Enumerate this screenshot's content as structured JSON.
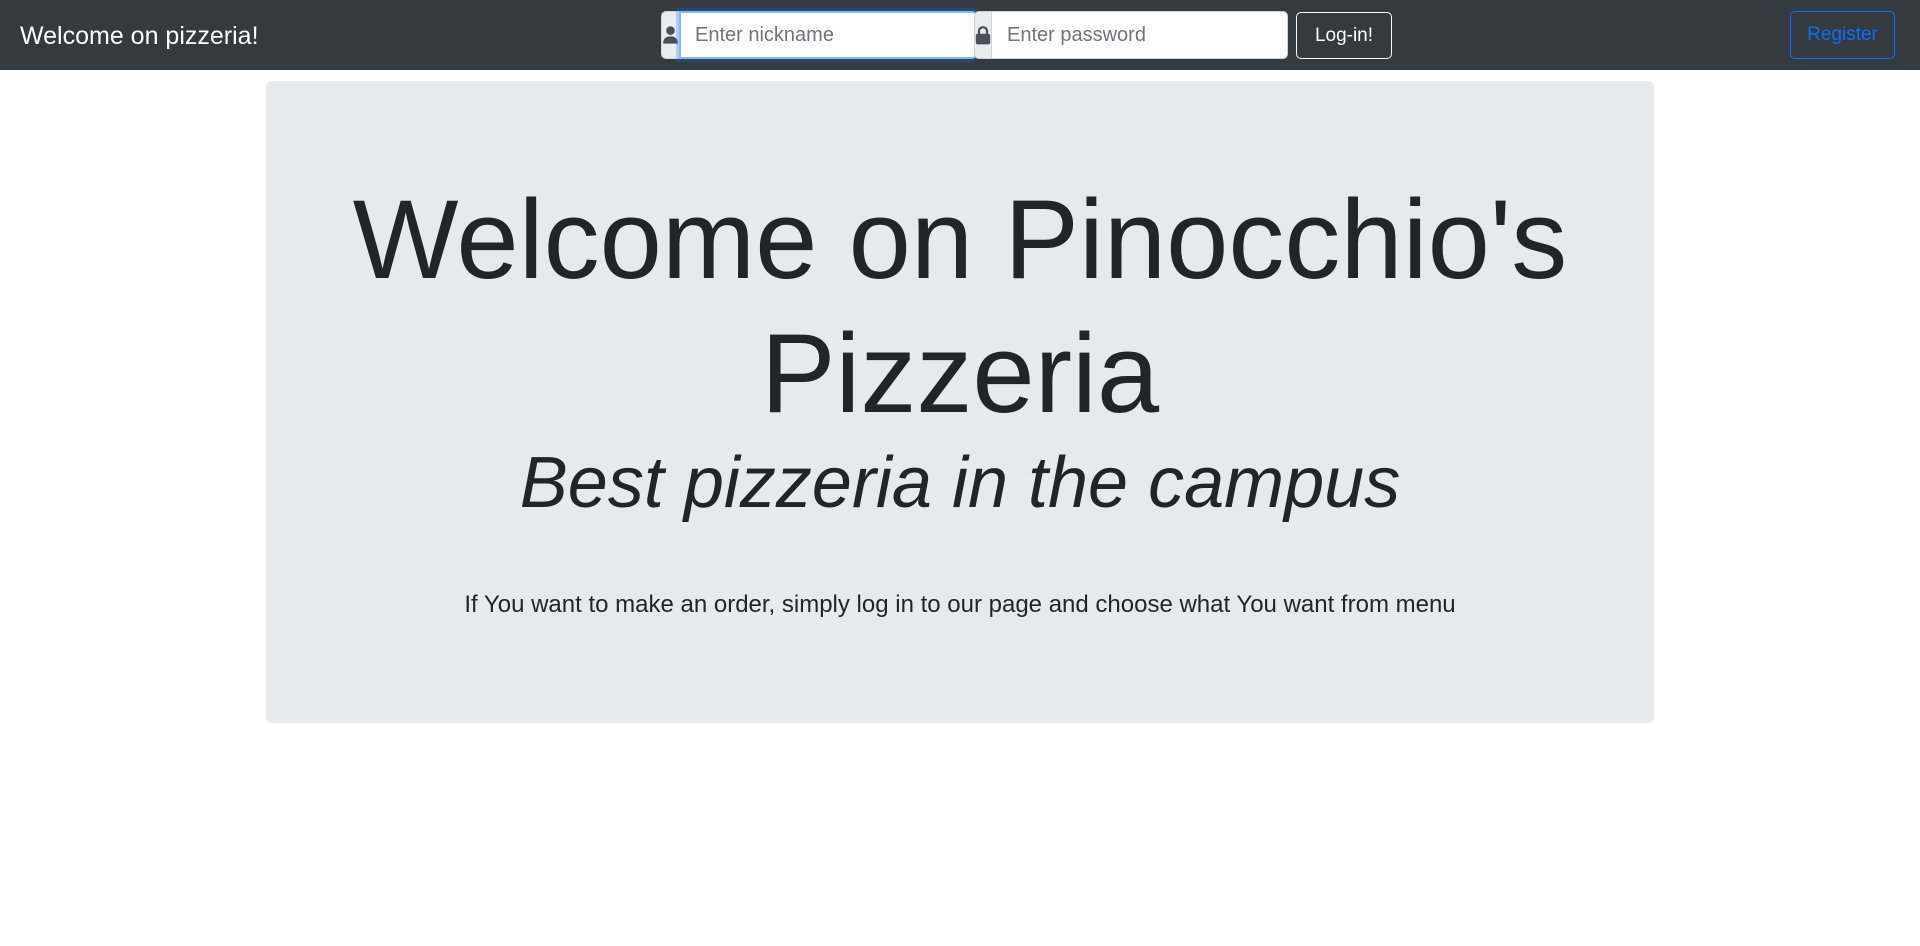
{
  "navbar": {
    "brand": "Welcome on pizzeria!",
    "login_form": {
      "nickname_placeholder": "Enter nickname",
      "nickname_value": "",
      "password_placeholder": "Enter password",
      "password_value": "",
      "login_label": "Log-in!",
      "user_icon": "user-icon",
      "lock_icon": "lock-icon"
    },
    "register_label": "Register"
  },
  "jumbotron": {
    "title": "Welcome on Pinocchio's Pizzeria",
    "subtitle": "Best pizzeria in the campus",
    "lead": "If You want to make an order, simply log in to our page and choose what You want from menu"
  },
  "colors": {
    "navbar_bg": "#343a40",
    "jumbotron_bg": "#e7eaed",
    "primary": "#0d6efd",
    "text": "#212529",
    "addon_bg": "#e9ecef"
  }
}
